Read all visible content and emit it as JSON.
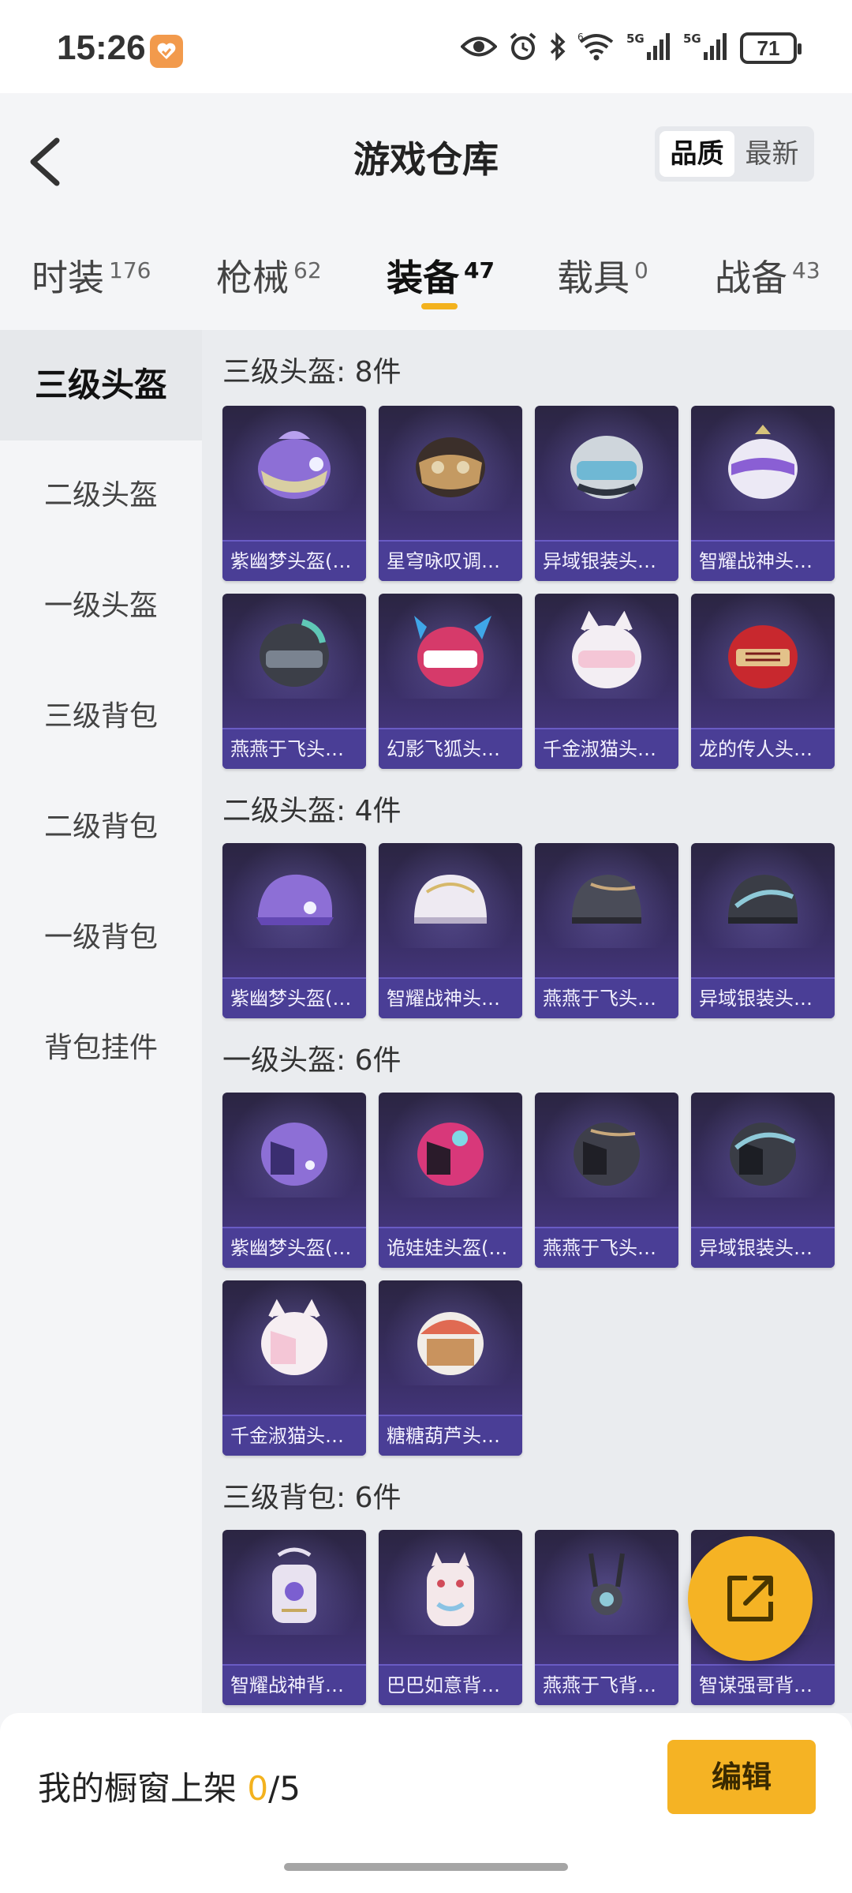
{
  "status_bar": {
    "time": "15:26",
    "network1": "6",
    "network2": "5G",
    "network3": "5G",
    "battery": "71",
    "icons": [
      "eye-icon",
      "alarm-icon",
      "bluetooth-icon",
      "wifi-icon",
      "signal-icon",
      "signal-icon",
      "battery-icon"
    ]
  },
  "header": {
    "title": "游戏仓库",
    "sort_options": [
      "品质",
      "最新"
    ],
    "active_sort": "品质"
  },
  "tabs": [
    {
      "label": "时装",
      "count": "176"
    },
    {
      "label": "枪械",
      "count": "62"
    },
    {
      "label": "装备",
      "count": "47",
      "active": true
    },
    {
      "label": "载具",
      "count": "0"
    },
    {
      "label": "战备",
      "count": "43"
    }
  ],
  "sidebar": {
    "items": [
      "三级头盔",
      "二级头盔",
      "一级头盔",
      "三级背包",
      "二级背包",
      "一级背包",
      "背包挂件"
    ],
    "active": "三级头盔"
  },
  "sections": [
    {
      "title": "三级头盔: 8件",
      "items": [
        "紫幽梦头盔(3...",
        "星穹咏叹调头...",
        "异域银装头盔...",
        "智耀战神头盔...",
        "燕燕于飞头盔...",
        "幻影飞狐头盔...",
        "千金淑猫头盔...",
        "龙的传人头盔..."
      ]
    },
    {
      "title": "二级头盔: 4件",
      "items": [
        "紫幽梦头盔(2...",
        "智耀战神头盔...",
        "燕燕于飞头盔...",
        "异域银装头盔..."
      ]
    },
    {
      "title": "一级头盔: 6件",
      "items": [
        "紫幽梦头盔(1...",
        "诡娃娃头盔(1...",
        "燕燕于飞头盔...",
        "异域银装头盔...",
        "千金淑猫头盔...",
        "糖糖葫芦头盔..."
      ]
    },
    {
      "title": "三级背包: 6件",
      "items": [
        "智耀战神背包...",
        "巴巴如意背包...",
        "燕燕于飞背包...",
        "智谋强哥背包..."
      ]
    }
  ],
  "colors": {
    "accent": "#f5b324",
    "card_bg": "#3a2f66",
    "card_label_bg": "#4a3e96"
  },
  "bottom_bar": {
    "label": "我的橱窗上架",
    "count": "0",
    "total": "/5",
    "edit_button": "编辑"
  }
}
